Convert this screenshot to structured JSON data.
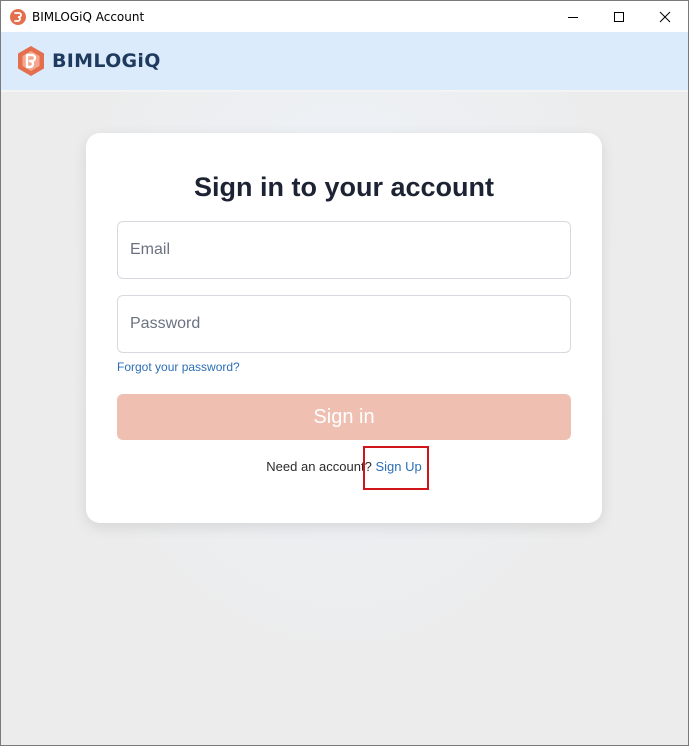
{
  "window": {
    "title": "BIMLOGiQ Account",
    "app_icon": "bimlogiq-logo-icon"
  },
  "brand": {
    "name": "BIMLOGiQ",
    "logo_icon": "bimlogiq-logo-icon",
    "accent": "#e36f4f",
    "text_color": "#1f3a5f"
  },
  "form": {
    "title": "Sign in to your account",
    "email_placeholder": "Email",
    "email_value": "",
    "password_placeholder": "Password",
    "password_value": "",
    "forgot_label": "Forgot your password?",
    "signin_label": "Sign in",
    "signin_color": "#efbfb1",
    "signup_prompt": "Need an account?",
    "signup_label": "Sign Up"
  },
  "colors": {
    "link": "#2d6fb5",
    "header_bg": "#dcebfb",
    "highlight": "#d0141a"
  }
}
